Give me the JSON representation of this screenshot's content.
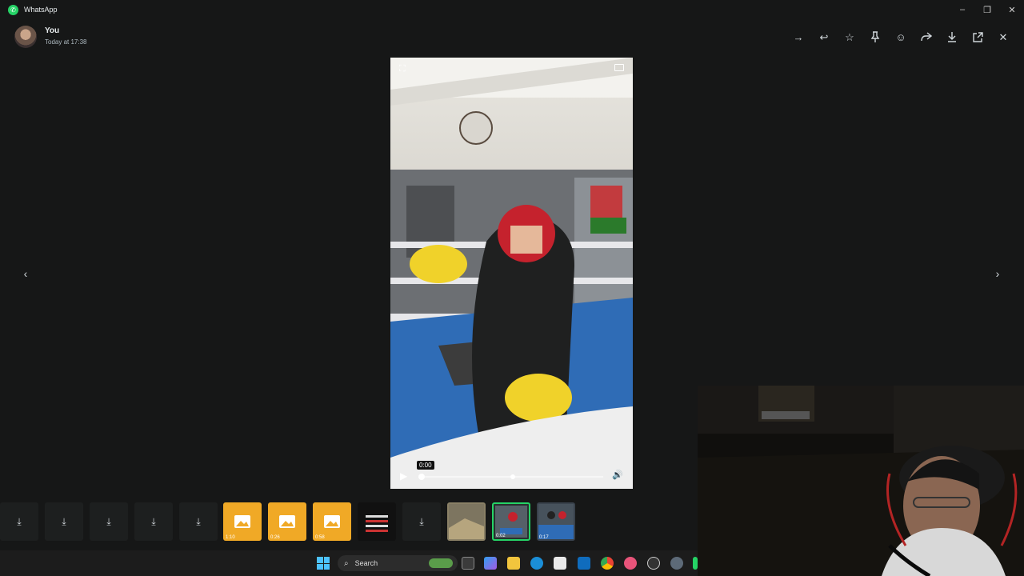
{
  "window": {
    "title": "WhatsApp"
  },
  "sender": {
    "name": "You",
    "time": "Today at 17:38"
  },
  "toolbar": {
    "icons": [
      "forward-arrow-icon",
      "reply-icon",
      "star-icon",
      "pin-icon",
      "emoji-icon",
      "share-icon",
      "download-icon",
      "open-external-icon",
      "close-icon"
    ]
  },
  "player": {
    "current_time": "0:00",
    "progress": 0.0,
    "volume_level": 1.0
  },
  "strip": {
    "durations": [
      "1:10",
      "0:26",
      "0:58",
      "0:02",
      "0:17"
    ]
  },
  "taskbar": {
    "search_label": "Search"
  }
}
